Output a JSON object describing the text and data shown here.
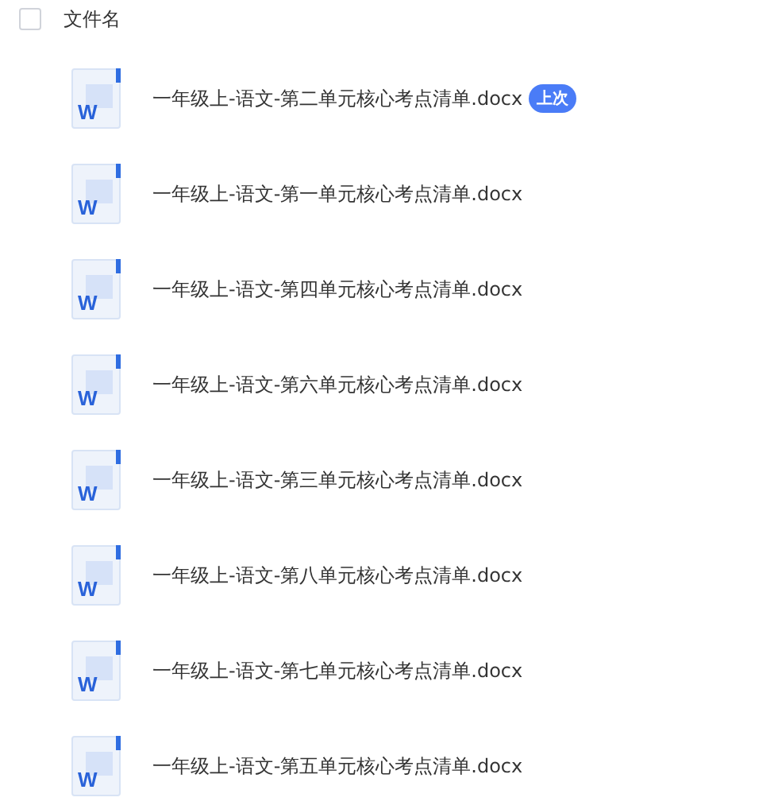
{
  "header": {
    "checkbox": {
      "checked": false
    },
    "label": "文件名"
  },
  "files": [
    {
      "name": "一年级上-语文-第二单元核心考点清单.docx",
      "icon_label": "W",
      "badge": "上次"
    },
    {
      "name": "一年级上-语文-第一单元核心考点清单.docx",
      "icon_label": "W"
    },
    {
      "name": "一年级上-语文-第四单元核心考点清单.docx",
      "icon_label": "W"
    },
    {
      "name": "一年级上-语文-第六单元核心考点清单.docx",
      "icon_label": "W"
    },
    {
      "name": "一年级上-语文-第三单元核心考点清单.docx",
      "icon_label": "W"
    },
    {
      "name": "一年级上-语文-第八单元核心考点清单.docx",
      "icon_label": "W"
    },
    {
      "name": "一年级上-语文-第七单元核心考点清单.docx",
      "icon_label": "W"
    },
    {
      "name": "一年级上-语文-第五单元核心考点清单.docx",
      "icon_label": "W"
    }
  ]
}
